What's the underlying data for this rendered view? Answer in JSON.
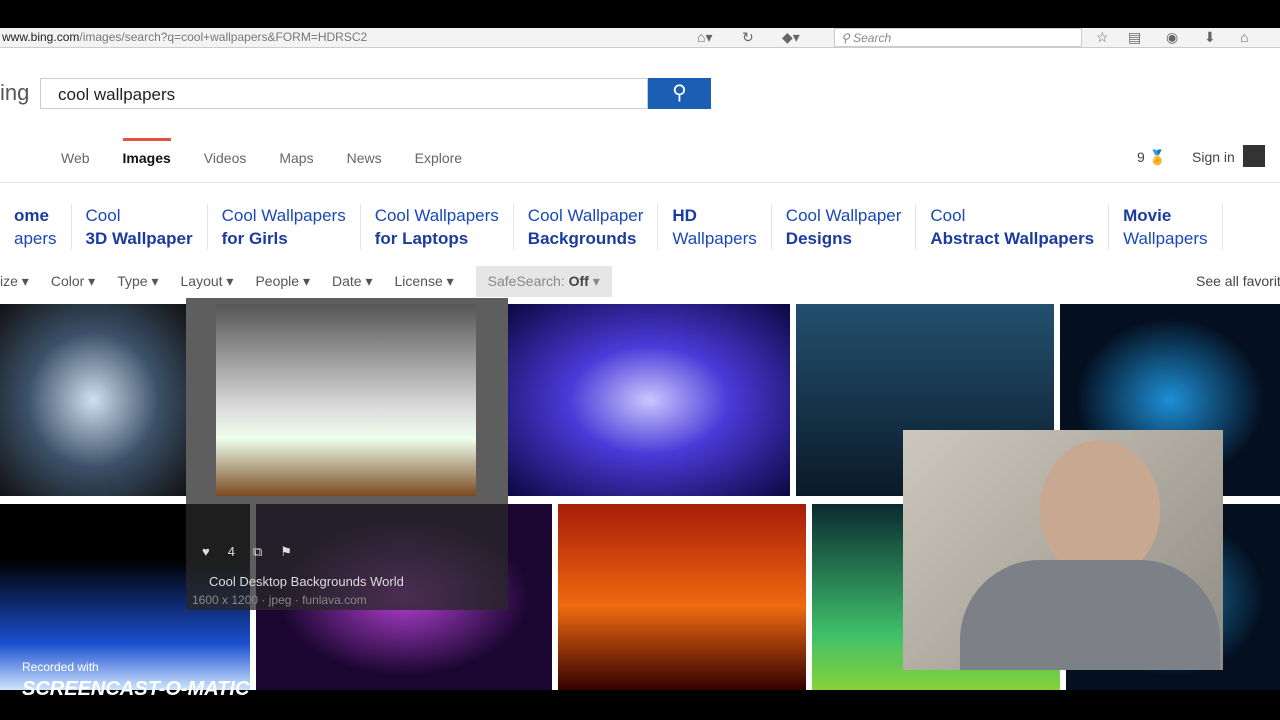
{
  "browser": {
    "url_domain": "www.bing.com",
    "url_path": "/images/search?q=cool+wallpapers&FORM=HDRSC2",
    "search_placeholder": "Search"
  },
  "header": {
    "logo": "ing",
    "query": "cool wallpapers",
    "search_icon": "magnifier-icon"
  },
  "nav": {
    "tabs": [
      "Web",
      "Images",
      "Videos",
      "Maps",
      "News",
      "Explore"
    ],
    "active": "Images",
    "rewards_count": "9",
    "sign_in": "Sign in"
  },
  "related": [
    {
      "l1": "ome",
      "l2": "apers",
      "bold": 1
    },
    {
      "l1": "Cool",
      "l2": "3D Wallpaper",
      "bold": 2
    },
    {
      "l1": "Cool Wallpapers",
      "l2": "for Girls",
      "bold": 2
    },
    {
      "l1": "Cool Wallpapers",
      "l2": "for Laptops",
      "bold": 2
    },
    {
      "l1": "Cool Wallpaper",
      "l2": "Backgrounds",
      "bold": 2
    },
    {
      "l1": "HD",
      "l2": "Wallpapers",
      "bold": 1
    },
    {
      "l1": "Cool Wallpaper",
      "l2": "Designs",
      "bold": 2
    },
    {
      "l1": "Cool",
      "l2": "Abstract Wallpapers",
      "bold": 2
    },
    {
      "l1": "Movie",
      "l2": "Wallpapers",
      "bold": 1
    }
  ],
  "filters": [
    "ize",
    "Color",
    "Type",
    "Layout",
    "People",
    "Date",
    "License"
  ],
  "safesearch": {
    "label": "SafeSearch:",
    "value": "Off"
  },
  "see_all": "See all favorite",
  "hover_card": {
    "title": "Cool Desktop Backgrounds World",
    "meta": "1600 x 1200 · jpeg · funlava.com",
    "likes": "4"
  },
  "watermark": {
    "line1": "Recorded with",
    "line2": "SCREENCAST-O-MATIC"
  }
}
